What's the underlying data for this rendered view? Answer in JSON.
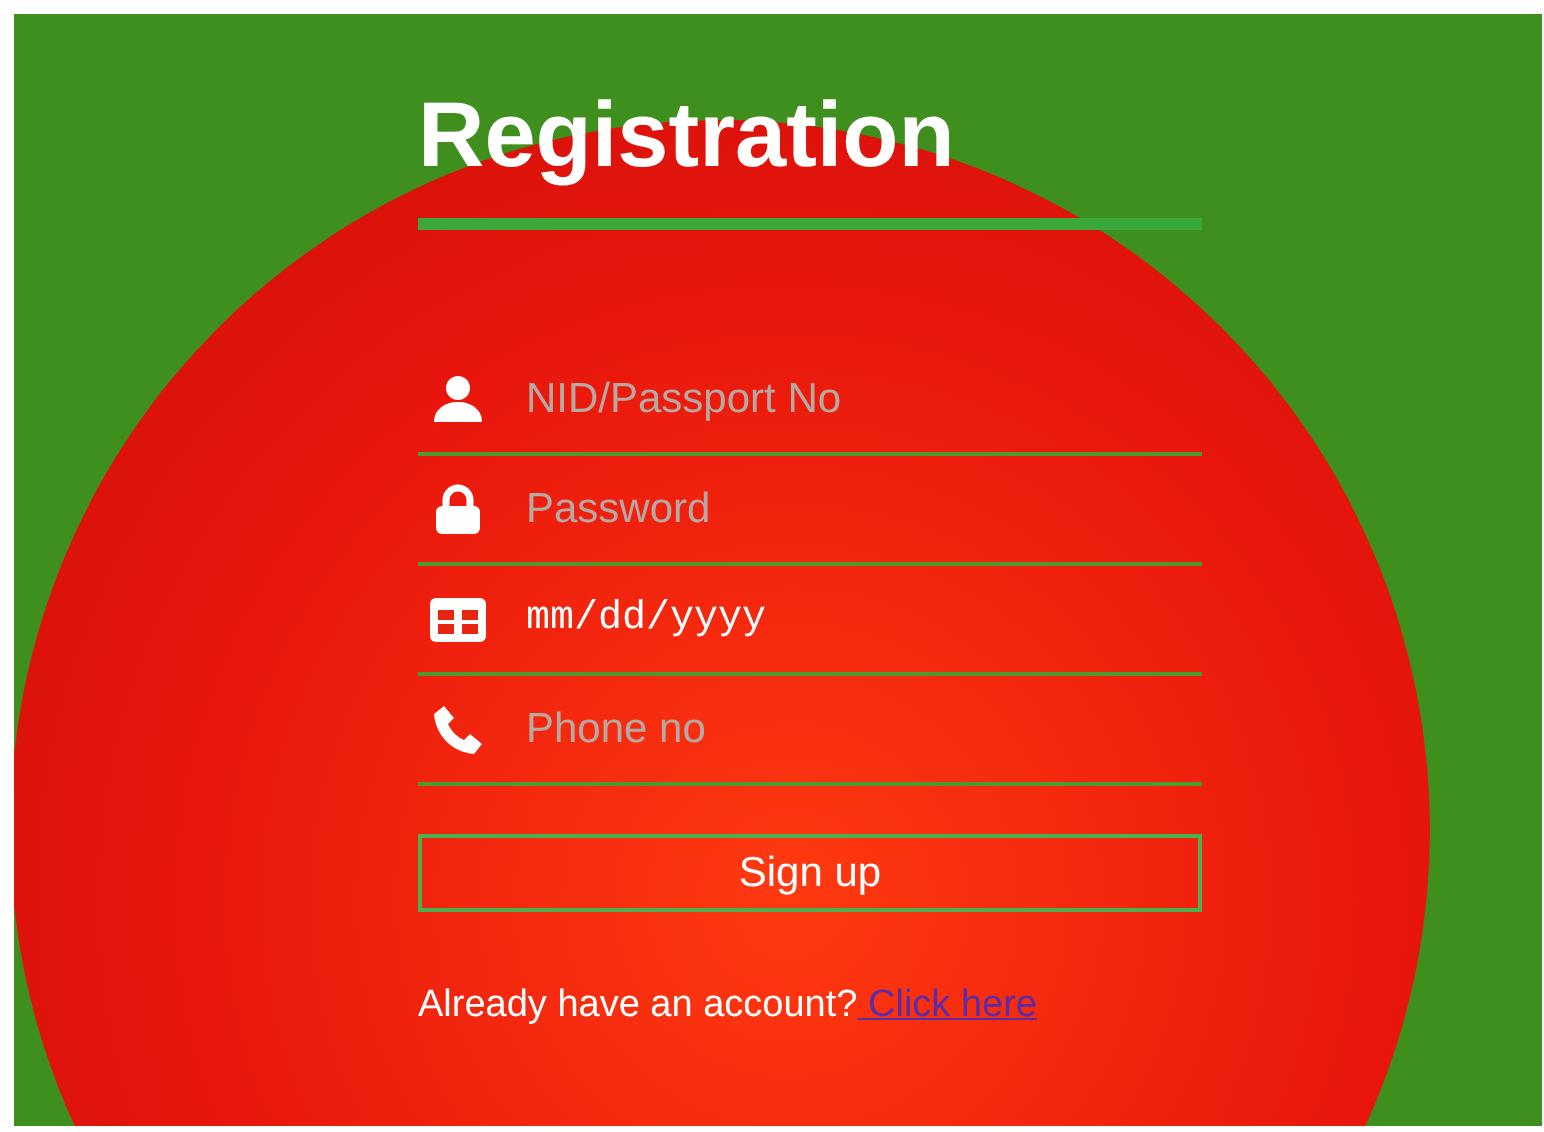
{
  "title": "Registration",
  "fields": [
    {
      "kind": "text",
      "placeholder": "NID/Passport No"
    },
    {
      "kind": "password",
      "placeholder": "Password"
    },
    {
      "kind": "date",
      "value": "mm/dd/yyyy"
    },
    {
      "kind": "tel",
      "placeholder": "Phone no"
    }
  ],
  "submit": "Sign up",
  "login_prompt": {
    "text": "Already have an account?",
    "link": " Click here"
  }
}
